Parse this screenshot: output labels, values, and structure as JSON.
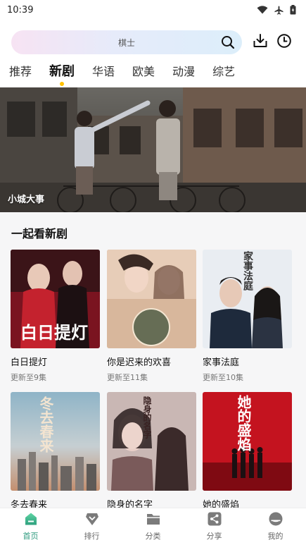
{
  "status": {
    "time": "10:39",
    "icons": [
      "wifi-icon",
      "airplane-icon",
      "battery-icon"
    ]
  },
  "search": {
    "placeholder": "棋士",
    "icons": [
      "search-icon",
      "download-icon",
      "history-icon"
    ]
  },
  "tabs": [
    {
      "label": "推荐",
      "active": false
    },
    {
      "label": "新剧",
      "active": true
    },
    {
      "label": "华语",
      "active": false
    },
    {
      "label": "欧美",
      "active": false
    },
    {
      "label": "动漫",
      "active": false
    },
    {
      "label": "综艺",
      "active": false
    }
  ],
  "banner": {
    "title": "小城大事"
  },
  "section": {
    "title": "一起看新剧",
    "items": [
      {
        "title": "白日提灯",
        "sub": "更新至9集",
        "poster_text": "白日提灯"
      },
      {
        "title": "你是迟来的欢喜",
        "sub": "更新至11集",
        "poster_text": ""
      },
      {
        "title": "家事法庭",
        "sub": "更新至10集",
        "poster_text": "家事法庭"
      },
      {
        "title": "冬去春来",
        "sub": "",
        "poster_text": "冬去春来"
      },
      {
        "title": "隐身的名字",
        "sub": "",
        "poster_text": "隐身的名字"
      },
      {
        "title": "她的盛焰",
        "sub": "",
        "poster_text": "她的盛焰"
      }
    ]
  },
  "nav": [
    {
      "label": "首页",
      "icon": "home-icon",
      "active": true
    },
    {
      "label": "排行",
      "icon": "ranking-icon",
      "active": false
    },
    {
      "label": "分类",
      "icon": "folder-icon",
      "active": false
    },
    {
      "label": "分享",
      "icon": "share-icon",
      "active": false
    },
    {
      "label": "我的",
      "icon": "profile-icon",
      "active": false
    }
  ],
  "colors": {
    "accent": "#2c9a7e",
    "tab_dot": "#ffc100",
    "section_bg": "#f6f6f7"
  }
}
